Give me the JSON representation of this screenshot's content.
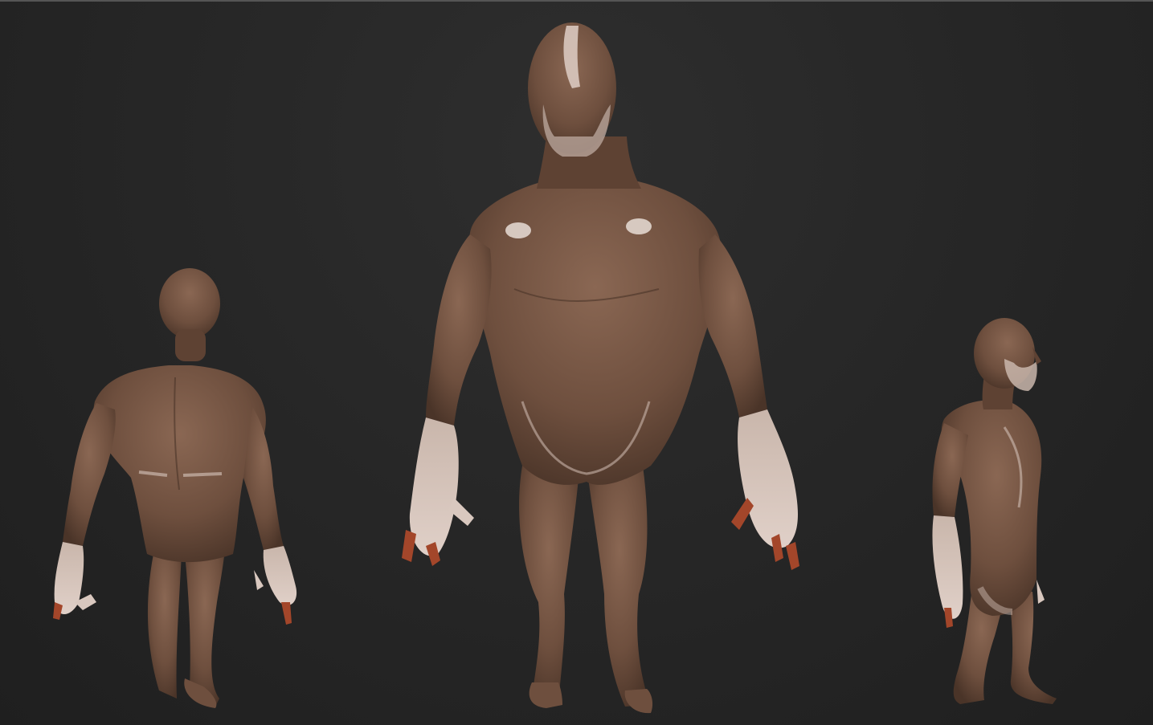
{
  "viewport": {
    "name": "3d-sculpt-viewport",
    "background_top": "#2e2e2e",
    "background_bottom": "#1f1f1f"
  },
  "models": [
    {
      "view": "back",
      "name": "back-view-model"
    },
    {
      "view": "front",
      "name": "front-view-model"
    },
    {
      "view": "side",
      "name": "side-view-model"
    }
  ],
  "colors": {
    "skin": "#6e4f3e",
    "skin_light": "#8a6753",
    "skin_dark": "#4a3428",
    "paint_white": "#d9c8bf",
    "nail_orange": "#a3462a"
  }
}
